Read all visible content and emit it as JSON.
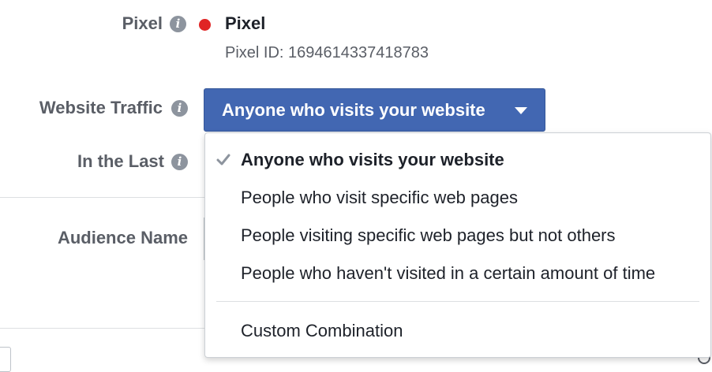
{
  "pixel": {
    "label": "Pixel",
    "name": "Pixel",
    "id_text": "Pixel ID: 1694614337418783",
    "status_color": "#e02424"
  },
  "website_traffic": {
    "label": "Website Traffic",
    "selected": "Anyone who visits your website",
    "options": [
      "Anyone who visits your website",
      "People who visit specific web pages",
      "People visiting specific web pages but not others",
      "People who haven't visited in a certain amount of time"
    ],
    "custom_option": "Custom Combination",
    "button_color": "#4267b2"
  },
  "in_the_last": {
    "label": "In the Last"
  },
  "audience_name": {
    "label": "Audience Name"
  },
  "icons": {
    "info": "info-icon",
    "check": "check-icon",
    "caret": "caret-down-icon",
    "status": "status-dot"
  }
}
